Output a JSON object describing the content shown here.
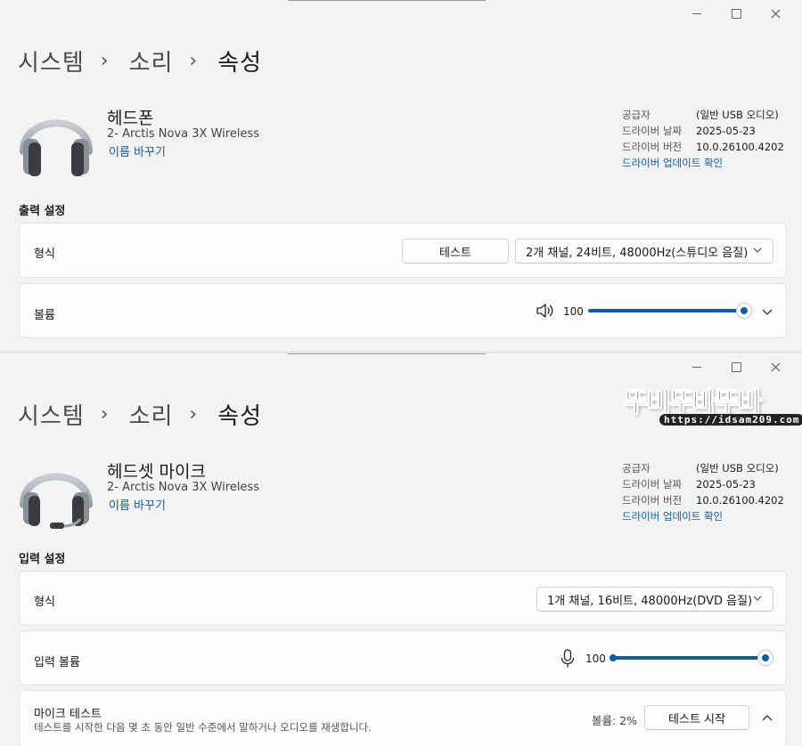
{
  "windows": [
    {
      "breadcrumb": [
        "시스템",
        "소리",
        "속성"
      ],
      "device": {
        "name": "헤드폰",
        "model": "2- Arctis Nova 3X Wireless",
        "rename": "이름 바꾸기",
        "icon": "headphones-icon"
      },
      "info": {
        "rows": [
          {
            "key": "공급자",
            "value": "(일반 USB 오디오)"
          },
          {
            "key": "드라이버 날짜",
            "value": "2025-05-23"
          },
          {
            "key": "드라이버 버전",
            "value": "10.0.26100.4202"
          }
        ],
        "update_link": "드라이버 업데이트 확인"
      },
      "section": "출력 설정",
      "format": {
        "label": "형식",
        "test_button": "테스트",
        "selected": "2개 채널, 24비트, 48000Hz(스튜디오 음질)"
      },
      "volume": {
        "label": "볼륨",
        "value": "100",
        "level": 1.0,
        "icon": "speaker-icon"
      }
    },
    {
      "breadcrumb": [
        "시스템",
        "소리",
        "속성"
      ],
      "device": {
        "name": "헤드셋 마이크",
        "model": "2- Arctis Nova 3X Wireless",
        "rename": "이름 바꾸기",
        "icon": "headset-icon"
      },
      "info": {
        "rows": [
          {
            "key": "공급자",
            "value": "(일반 USB 오디오)"
          },
          {
            "key": "드라이버 날짜",
            "value": "2025-05-23"
          },
          {
            "key": "드라이버 버전",
            "value": "10.0.26100.4202"
          }
        ],
        "update_link": "드라이버 업데이트 확인"
      },
      "section": "입력 설정",
      "format": {
        "label": "형식",
        "selected": "1개 채널, 16비트, 48000Hz(DVD 음질)"
      },
      "volume": {
        "label": "입력 볼륨",
        "value": "100",
        "level": 1.0,
        "icon": "microphone-icon"
      },
      "mic_test": {
        "title": "마이크 테스트",
        "description": "테스트를 시작한 다음 몇 초 동안 일반 수준에서 말하거나 오디오를 재생합니다.",
        "level_text": "볼륨: 2%",
        "button": "테스트 시작"
      }
    }
  ],
  "watermark": {
    "title": "뚜비뚜바뚜바",
    "url": "https://idsam209.com"
  },
  "colors": {
    "accent": "#0f5cae",
    "background": "#f3f3f3",
    "card": "#fbfbfb"
  }
}
